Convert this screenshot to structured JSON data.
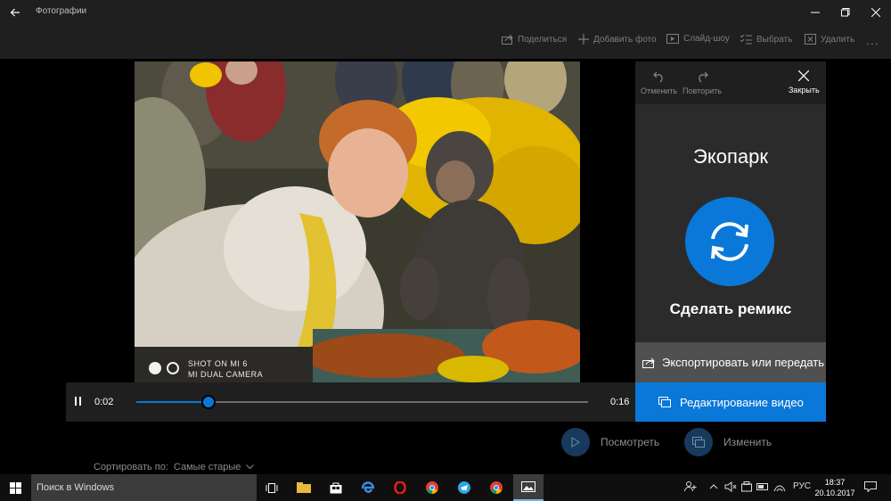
{
  "window": {
    "title": "Фотографии",
    "icons": {
      "back": "back-arrow-icon",
      "minimize": "minimize-icon",
      "maximize": "maximize-icon",
      "close": "close-icon"
    }
  },
  "toolbar": {
    "share": "Поделиться",
    "add_photo": "Добавить фото",
    "slideshow": "Слайд-шоу",
    "select": "Выбрать",
    "delete": "Удалить",
    "more": "..."
  },
  "photo": {
    "watermark_line1": "SHOT ON MI 6",
    "watermark_line2": "MI DUAL CAMERA"
  },
  "panel": {
    "undo": "Отменить",
    "redo": "Повторить",
    "close": "Закрыть",
    "title": "Экопарк",
    "remix": "Сделать ремикс",
    "export": "Экспортировать или передать"
  },
  "player": {
    "current_time": "0:02",
    "total_time": "0:16",
    "progress": 0.16
  },
  "edit_video": "Редактирование видео",
  "actions": {
    "watch": "Посмотреть",
    "change": "Изменить"
  },
  "sort": {
    "label": "Сортировать по:",
    "value": "Самые старые"
  },
  "taskbar": {
    "search_placeholder": "Поиск в Windows",
    "language": "РУС",
    "time": "18:37",
    "date": "20.10.2017"
  },
  "colors": {
    "accent": "#0a78d8",
    "chrome": "#1f1f1f",
    "panel": "#2b2b2b"
  }
}
